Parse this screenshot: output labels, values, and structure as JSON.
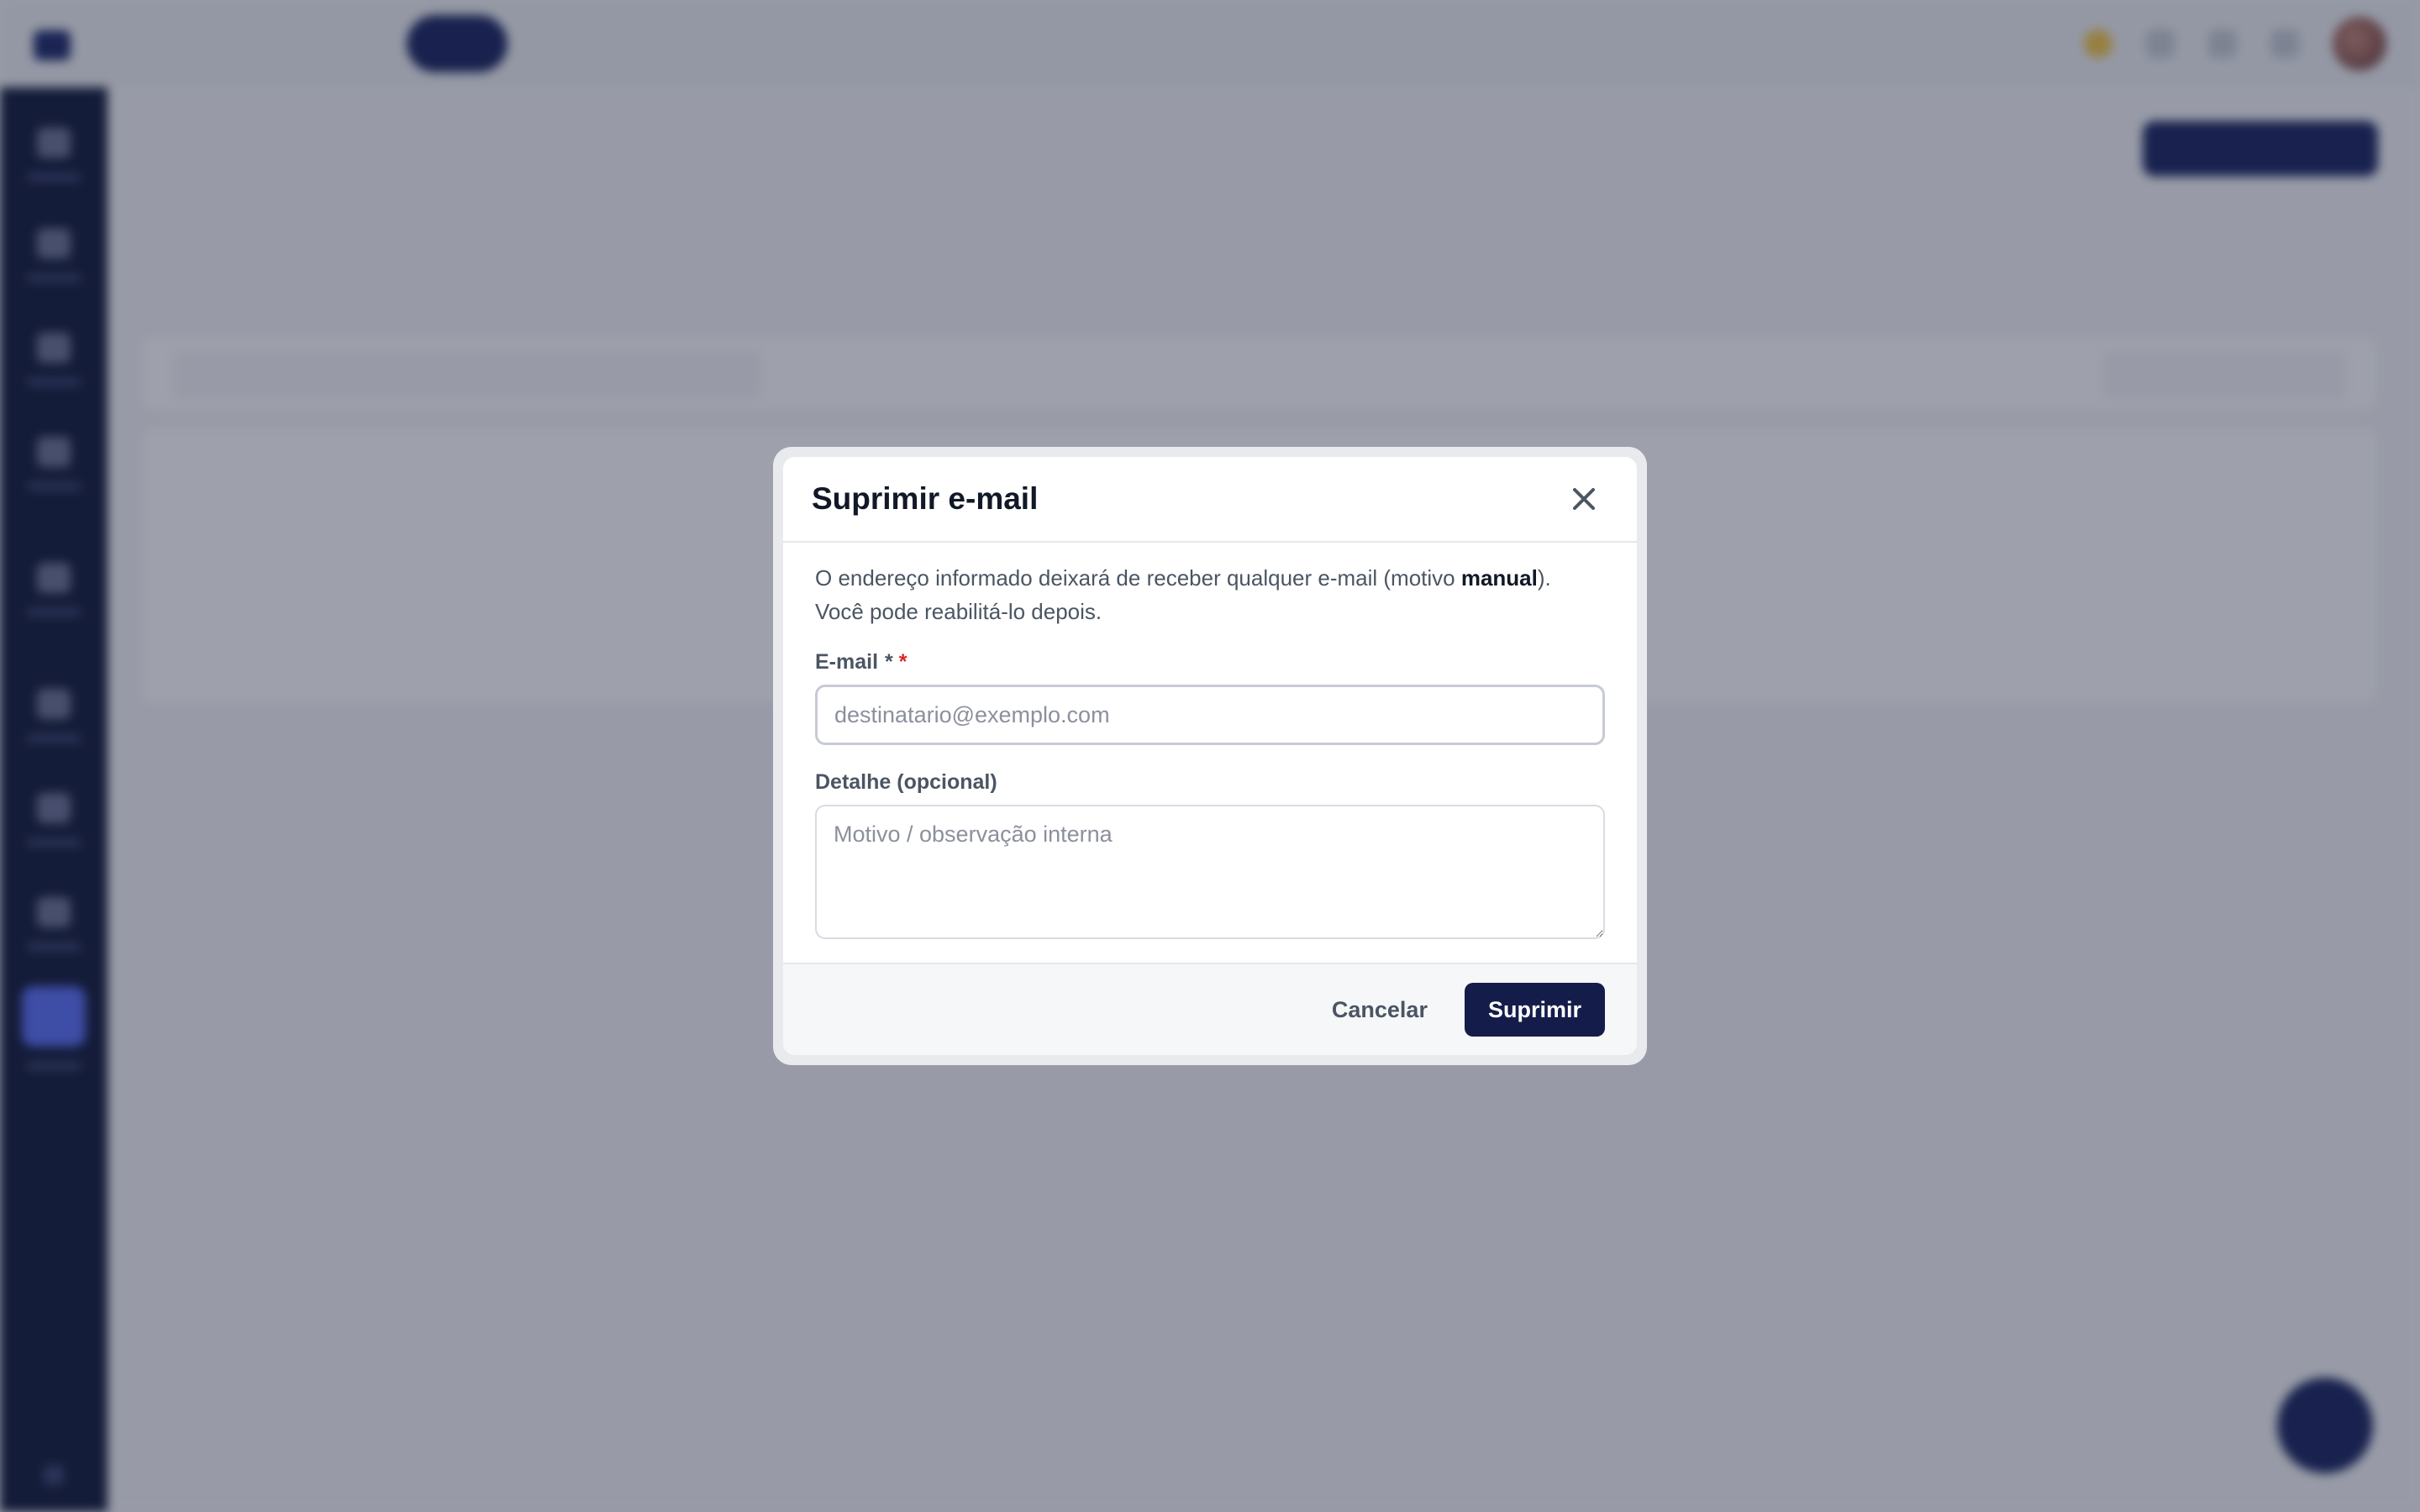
{
  "modal": {
    "title": "Suprimir e-mail",
    "close_icon": "close-icon",
    "description_before": "O endereço informado deixará de receber qualquer e-mail (motivo ",
    "description_bold": "manual",
    "description_after": ").",
    "description_line2": "Você pode reabilitá-lo depois.",
    "email_label": "E-mail",
    "email_required_marks": [
      "*",
      "*"
    ],
    "email_value": "",
    "email_placeholder": "destinatario@exemplo.com",
    "detail_label": "Detalhe (opcional)",
    "detail_value": "",
    "detail_placeholder": "Motivo / observação interna",
    "cancel_label": "Cancelar",
    "submit_label": "Suprimir"
  },
  "colors": {
    "primary": "#141d4a",
    "required": "#dc2626",
    "sidebar": "#111a3a",
    "sidebar_active": "#5b6ef5"
  }
}
